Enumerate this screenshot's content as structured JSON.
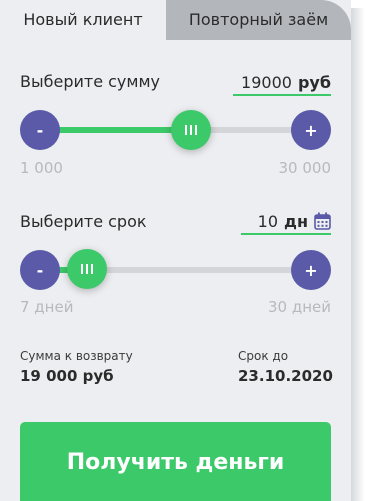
{
  "tabs": {
    "new_client": "Новый клиент",
    "repeat_loan": "Повторный заём"
  },
  "amount": {
    "label": "Выберите сумму",
    "value": "19000",
    "unit": "руб",
    "min": "1 000",
    "max": "30 000",
    "minus": "-",
    "plus": "+",
    "progress_fraction": 0.62
  },
  "term": {
    "label": "Выберите срок",
    "value": "10",
    "unit": "дн",
    "min": "7 дней",
    "max": "30 дней",
    "minus": "-",
    "plus": "+",
    "progress_fraction": 0.13
  },
  "summary": {
    "return_label": "Сумма к возврату",
    "return_value": "19 000 руб",
    "date_label": "Срок до",
    "date_value": "23.10.2020"
  },
  "cta": {
    "label": "Получить деньги"
  },
  "colors": {
    "accent": "#3cc96a",
    "button": "#5a5aa8",
    "card": "#eceef1"
  },
  "icons": [
    "calendar-icon"
  ]
}
